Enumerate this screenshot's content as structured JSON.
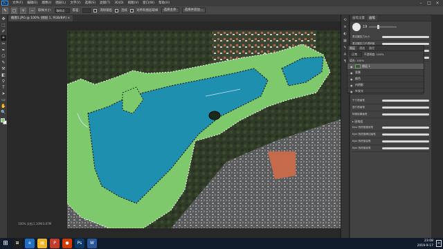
{
  "menubar": {
    "logo": "Ps",
    "items": [
      "文件(F)",
      "编辑(E)",
      "图像(I)",
      "图层(L)",
      "文字(Y)",
      "选择(S)",
      "滤镜(T)",
      "3D(D)",
      "视图(V)",
      "窗口(W)",
      "帮助(H)"
    ],
    "minimize": "–",
    "maximize": "□",
    "close": "×"
  },
  "options": {
    "tool_icon": "✎",
    "sample_label": "取样大小:",
    "sample_value": "取样点",
    "tolerance_label": "容差:",
    "antialias_label": "消除锯齿",
    "contiguous_label": "连续",
    "all_layers_label": "对所有图层取样",
    "select_subject": "选择主体",
    "select_mask": "选择并遮住..."
  },
  "tools": [
    "✥",
    "⬚",
    "✐",
    "⌗",
    "✂",
    "✒",
    "⎔",
    "✎",
    "⚒",
    "◧",
    "⚲",
    "T",
    "➤",
    "▭",
    "✋",
    "🔍"
  ],
  "document": {
    "tab_label": "截图1.JPG @ 100% (图层 1, RGB/8#) ×",
    "status": "100%    文档:1.10M/3.67M"
  },
  "panels": {
    "top_tabs": [
      "画笔设置",
      "画笔"
    ],
    "brush_size": "19",
    "layer_tabs": [
      "图层",
      "通道",
      "路径"
    ],
    "blend_mode": "正常",
    "opacity_label": "不透明度: 100%",
    "fill_label": "填充: 100%",
    "layers": [
      {
        "name": "图层 1",
        "selected": true
      },
      {
        "name": "背景",
        "selected": false
      },
      {
        "name": "颜色",
        "selected": false
      },
      {
        "name": "内阴影",
        "selected": false
      },
      {
        "name": "外发光",
        "selected": false
      }
    ],
    "brushes": [
      "柔边圆压力大小",
      "柔边圆压力不透明度",
      "硬边圆压力大小",
      "硬边圆压力不透明度",
      "干介质画笔",
      "湿介质画笔",
      "特殊效果画笔",
      "Kyle 的终极粗炭笔",
      "Kyle 的终极硬边画笔",
      "Kyle 的终极铅笔",
      "Kyle 的终极炭笔"
    ],
    "group_label": "▸ 画笔组"
  },
  "taskbar": {
    "apps": [
      {
        "icon": "⊞",
        "color": "#1e1e1e"
      },
      {
        "icon": "e",
        "color": "#1f6fc4"
      },
      {
        "icon": "▤",
        "color": "#f0b429"
      },
      {
        "icon": "P",
        "color": "#c43d2b"
      },
      {
        "icon": "●",
        "color": "#d83b01"
      },
      {
        "icon": "Ps",
        "color": "#0a3a6a"
      },
      {
        "icon": "W",
        "color": "#2b579a"
      }
    ],
    "time": "23:08",
    "date": "2019-9-17",
    "notify": "≡"
  },
  "colors": {
    "land_selection": "#7ec96c",
    "water": "#1f8fb0",
    "canvas_bg": "#282828"
  }
}
